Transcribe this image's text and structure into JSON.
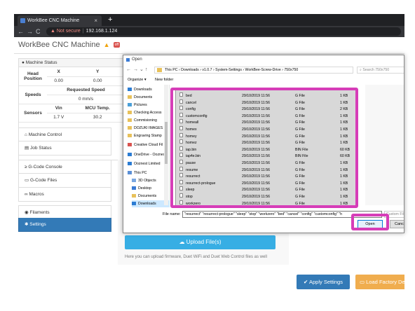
{
  "browser": {
    "tab_title": "WorkBee CNC Machine",
    "tab_close": "×",
    "new_tab": "+",
    "back": "←",
    "forward": "→",
    "reload": "C",
    "not_secure": "Not secure",
    "url": "192.168.1.124"
  },
  "app": {
    "title": "WorkBee CNC Machine",
    "warning_icon": "warning-icon",
    "off_badge": "off"
  },
  "machine_status": {
    "heading": "Machine Status",
    "head_position_label": "Head Position",
    "axes": [
      "X",
      "Y"
    ],
    "axis_values": [
      "0.00",
      "0.00"
    ],
    "speeds_label": "Speeds",
    "requested_speed_label": "Requested Speed",
    "requested_speed_value": "0 mm/s",
    "sensors_label": "Sensors",
    "vin_label": "Vin",
    "mcu_temp_label": "MCU Temp.",
    "vin_value": "1.7 V",
    "mcu_temp_value": "30.2"
  },
  "menu": {
    "machine_control": "Machine Control",
    "job_status": "Job Status",
    "gcode_console": "G-Code Console",
    "gcode_files": "G-Code Files",
    "macros": "Macros",
    "filaments": "Filaments",
    "settings": "Settings"
  },
  "settings_page": {
    "upload_button": "Upload File(s)",
    "upload_help": "Here you can upload firmware, Duet WiFi and Duet Web Control files as well",
    "apply_button": "Apply Settings",
    "factory_button": "Load Factory De"
  },
  "dialog": {
    "title": "Open",
    "path": [
      "This PC",
      "Downloads",
      "v1.0.7",
      "System-Settings",
      "WorkBee-Screw-Drive",
      "750x750"
    ],
    "search_placeholder": "Search 750x750",
    "organize": "Organize ▾",
    "new_folder": "New folder",
    "nav_items": [
      {
        "label": "Downloads"
      },
      {
        "label": "Documents"
      },
      {
        "label": "Pictures"
      },
      {
        "label": "Checking Access"
      },
      {
        "label": "Commisioning"
      },
      {
        "label": "DOZUKI IMAGES"
      },
      {
        "label": "Engraving Stamp"
      },
      {
        "label": "Creative Cloud Fil"
      },
      {
        "label": "OneDrive - Ooznes"
      },
      {
        "label": "Ooznest Limited"
      },
      {
        "label": "This PC"
      },
      {
        "label": "3D Objects"
      },
      {
        "label": "Desktop"
      },
      {
        "label": "Documents"
      },
      {
        "label": "Downloads"
      }
    ],
    "files": [
      {
        "name": "bed",
        "date": "29/10/2019 11:56",
        "type": "G File",
        "size": "1 KB"
      },
      {
        "name": "cancel",
        "date": "29/10/2019 11:56",
        "type": "G File",
        "size": "1 KB"
      },
      {
        "name": "config",
        "date": "29/10/2019 11:56",
        "type": "G File",
        "size": "2 KB"
      },
      {
        "name": "customconfig",
        "date": "29/10/2019 11:56",
        "type": "G File",
        "size": "1 KB"
      },
      {
        "name": "homeall",
        "date": "29/10/2019 11:56",
        "type": "G File",
        "size": "1 KB"
      },
      {
        "name": "homex",
        "date": "29/10/2019 11:56",
        "type": "G File",
        "size": "1 KB"
      },
      {
        "name": "homey",
        "date": "29/10/2019 11:56",
        "type": "G File",
        "size": "1 KB"
      },
      {
        "name": "homez",
        "date": "29/10/2019 11:56",
        "type": "G File",
        "size": "1 KB"
      },
      {
        "name": "iap.bin",
        "date": "29/10/2019 11:56",
        "type": "BIN File",
        "size": "60 KB"
      },
      {
        "name": "iap4e.bin",
        "date": "29/10/2019 11:56",
        "type": "BIN File",
        "size": "60 KB"
      },
      {
        "name": "pause",
        "date": "29/10/2019 11:56",
        "type": "G File",
        "size": "1 KB"
      },
      {
        "name": "resume",
        "date": "29/10/2019 11:56",
        "type": "G File",
        "size": "1 KB"
      },
      {
        "name": "resurrect",
        "date": "29/10/2019 11:56",
        "type": "G File",
        "size": "1 KB"
      },
      {
        "name": "resurrect-prologue",
        "date": "29/10/2019 11:56",
        "type": "G File",
        "size": "1 KB"
      },
      {
        "name": "sleep",
        "date": "29/10/2019 11:56",
        "type": "G File",
        "size": "1 KB"
      },
      {
        "name": "stop",
        "date": "29/10/2019 11:56",
        "type": "G File",
        "size": "1 KB"
      },
      {
        "name": "workzero",
        "date": "29/10/2019 11:56",
        "type": "G File",
        "size": "1 KB"
      }
    ],
    "file_name_label": "File name:",
    "file_name_value": "\"resurrect\" \"resurrect-prologue\" \"sleep\" \"stop\" \"workzero\" \"bed\" \"cancel\" \"config\" \"customconfig\" \"h",
    "file_type_value": "Custom Files",
    "open_button": "Open",
    "cancel_button": "Cancel"
  },
  "colors": {
    "highlight": "#d63db8",
    "primary": "#337ab7",
    "upload": "#37aee4",
    "warning": "#f0ad4e"
  }
}
